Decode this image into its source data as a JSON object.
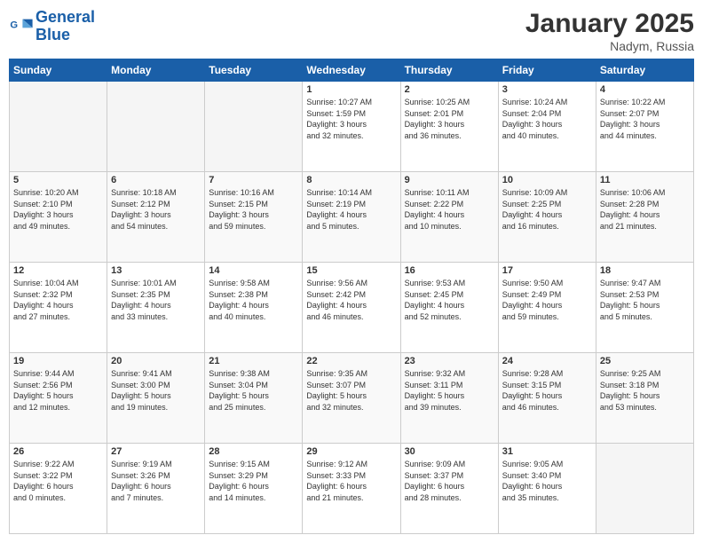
{
  "header": {
    "logo_line1": "General",
    "logo_line2": "Blue",
    "month": "January 2025",
    "location": "Nadym, Russia"
  },
  "weekdays": [
    "Sunday",
    "Monday",
    "Tuesday",
    "Wednesday",
    "Thursday",
    "Friday",
    "Saturday"
  ],
  "weeks": [
    [
      {
        "day": "",
        "detail": ""
      },
      {
        "day": "",
        "detail": ""
      },
      {
        "day": "",
        "detail": ""
      },
      {
        "day": "1",
        "detail": "Sunrise: 10:27 AM\nSunset: 1:59 PM\nDaylight: 3 hours\nand 32 minutes."
      },
      {
        "day": "2",
        "detail": "Sunrise: 10:25 AM\nSunset: 2:01 PM\nDaylight: 3 hours\nand 36 minutes."
      },
      {
        "day": "3",
        "detail": "Sunrise: 10:24 AM\nSunset: 2:04 PM\nDaylight: 3 hours\nand 40 minutes."
      },
      {
        "day": "4",
        "detail": "Sunrise: 10:22 AM\nSunset: 2:07 PM\nDaylight: 3 hours\nand 44 minutes."
      }
    ],
    [
      {
        "day": "5",
        "detail": "Sunrise: 10:20 AM\nSunset: 2:10 PM\nDaylight: 3 hours\nand 49 minutes."
      },
      {
        "day": "6",
        "detail": "Sunrise: 10:18 AM\nSunset: 2:12 PM\nDaylight: 3 hours\nand 54 minutes."
      },
      {
        "day": "7",
        "detail": "Sunrise: 10:16 AM\nSunset: 2:15 PM\nDaylight: 3 hours\nand 59 minutes."
      },
      {
        "day": "8",
        "detail": "Sunrise: 10:14 AM\nSunset: 2:19 PM\nDaylight: 4 hours\nand 5 minutes."
      },
      {
        "day": "9",
        "detail": "Sunrise: 10:11 AM\nSunset: 2:22 PM\nDaylight: 4 hours\nand 10 minutes."
      },
      {
        "day": "10",
        "detail": "Sunrise: 10:09 AM\nSunset: 2:25 PM\nDaylight: 4 hours\nand 16 minutes."
      },
      {
        "day": "11",
        "detail": "Sunrise: 10:06 AM\nSunset: 2:28 PM\nDaylight: 4 hours\nand 21 minutes."
      }
    ],
    [
      {
        "day": "12",
        "detail": "Sunrise: 10:04 AM\nSunset: 2:32 PM\nDaylight: 4 hours\nand 27 minutes."
      },
      {
        "day": "13",
        "detail": "Sunrise: 10:01 AM\nSunset: 2:35 PM\nDaylight: 4 hours\nand 33 minutes."
      },
      {
        "day": "14",
        "detail": "Sunrise: 9:58 AM\nSunset: 2:38 PM\nDaylight: 4 hours\nand 40 minutes."
      },
      {
        "day": "15",
        "detail": "Sunrise: 9:56 AM\nSunset: 2:42 PM\nDaylight: 4 hours\nand 46 minutes."
      },
      {
        "day": "16",
        "detail": "Sunrise: 9:53 AM\nSunset: 2:45 PM\nDaylight: 4 hours\nand 52 minutes."
      },
      {
        "day": "17",
        "detail": "Sunrise: 9:50 AM\nSunset: 2:49 PM\nDaylight: 4 hours\nand 59 minutes."
      },
      {
        "day": "18",
        "detail": "Sunrise: 9:47 AM\nSunset: 2:53 PM\nDaylight: 5 hours\nand 5 minutes."
      }
    ],
    [
      {
        "day": "19",
        "detail": "Sunrise: 9:44 AM\nSunset: 2:56 PM\nDaylight: 5 hours\nand 12 minutes."
      },
      {
        "day": "20",
        "detail": "Sunrise: 9:41 AM\nSunset: 3:00 PM\nDaylight: 5 hours\nand 19 minutes."
      },
      {
        "day": "21",
        "detail": "Sunrise: 9:38 AM\nSunset: 3:04 PM\nDaylight: 5 hours\nand 25 minutes."
      },
      {
        "day": "22",
        "detail": "Sunrise: 9:35 AM\nSunset: 3:07 PM\nDaylight: 5 hours\nand 32 minutes."
      },
      {
        "day": "23",
        "detail": "Sunrise: 9:32 AM\nSunset: 3:11 PM\nDaylight: 5 hours\nand 39 minutes."
      },
      {
        "day": "24",
        "detail": "Sunrise: 9:28 AM\nSunset: 3:15 PM\nDaylight: 5 hours\nand 46 minutes."
      },
      {
        "day": "25",
        "detail": "Sunrise: 9:25 AM\nSunset: 3:18 PM\nDaylight: 5 hours\nand 53 minutes."
      }
    ],
    [
      {
        "day": "26",
        "detail": "Sunrise: 9:22 AM\nSunset: 3:22 PM\nDaylight: 6 hours\nand 0 minutes."
      },
      {
        "day": "27",
        "detail": "Sunrise: 9:19 AM\nSunset: 3:26 PM\nDaylight: 6 hours\nand 7 minutes."
      },
      {
        "day": "28",
        "detail": "Sunrise: 9:15 AM\nSunset: 3:29 PM\nDaylight: 6 hours\nand 14 minutes."
      },
      {
        "day": "29",
        "detail": "Sunrise: 9:12 AM\nSunset: 3:33 PM\nDaylight: 6 hours\nand 21 minutes."
      },
      {
        "day": "30",
        "detail": "Sunrise: 9:09 AM\nSunset: 3:37 PM\nDaylight: 6 hours\nand 28 minutes."
      },
      {
        "day": "31",
        "detail": "Sunrise: 9:05 AM\nSunset: 3:40 PM\nDaylight: 6 hours\nand 35 minutes."
      },
      {
        "day": "",
        "detail": ""
      }
    ]
  ]
}
